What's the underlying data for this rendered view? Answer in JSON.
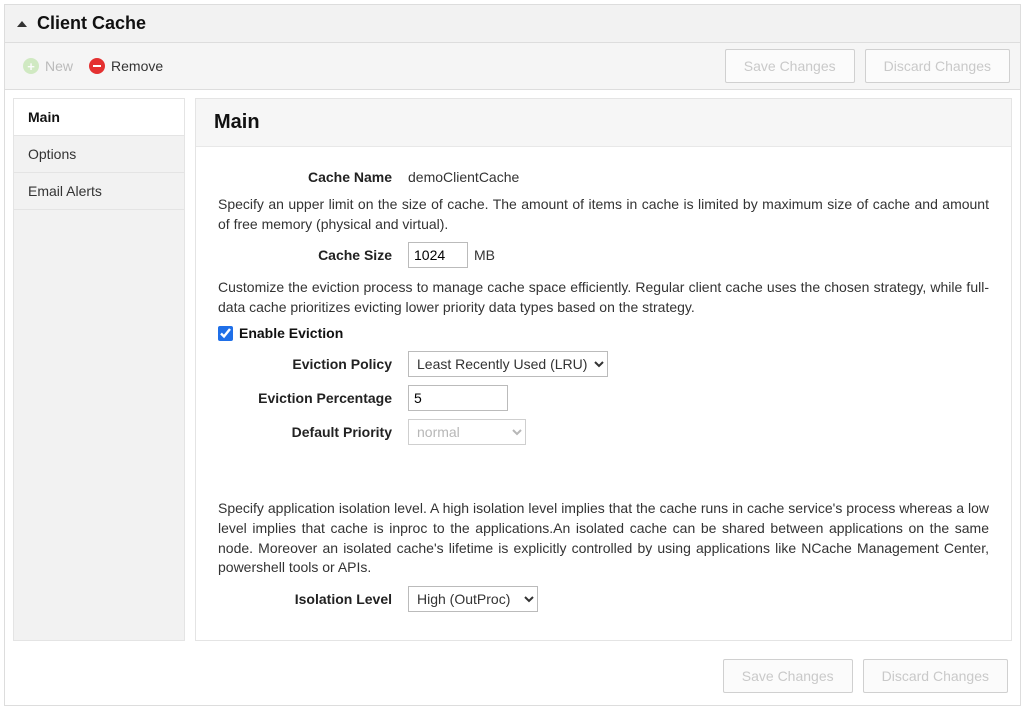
{
  "header": {
    "title": "Client Cache"
  },
  "toolbar": {
    "new_label": "New",
    "remove_label": "Remove",
    "save_label": "Save Changes",
    "discard_label": "Discard Changes"
  },
  "sidebar": {
    "tabs": [
      {
        "label": "Main",
        "active": true
      },
      {
        "label": "Options",
        "active": false
      },
      {
        "label": "Email Alerts",
        "active": false
      }
    ]
  },
  "content": {
    "title": "Main",
    "cache_name_label": "Cache Name",
    "cache_name_value": "demoClientCache",
    "size_desc": "Specify an upper limit on the size of cache. The amount of items in cache is limited by maximum size of cache and amount of free memory (physical and virtual).",
    "cache_size_label": "Cache Size",
    "cache_size_value": "1024",
    "cache_size_unit": "MB",
    "eviction_desc": "Customize the eviction process to manage cache space efficiently. Regular client cache uses the chosen strategy, while full-data cache prioritizes evicting lower priority data types based on the strategy.",
    "enable_eviction_label": "Enable Eviction",
    "enable_eviction_checked": true,
    "eviction_policy_label": "Eviction Policy",
    "eviction_policy_value": "Least Recently Used (LRU)",
    "eviction_percentage_label": "Eviction Percentage",
    "eviction_percentage_value": "5",
    "default_priority_label": "Default Priority",
    "default_priority_value": "normal",
    "isolation_desc": "Specify application isolation level. A high isolation level implies that the cache runs in cache service's process whereas a low level implies that cache is inproc to the applications.An isolated cache can be shared between applications on the same node. Moreover an isolated cache's lifetime is explicitly controlled by using applications like NCache Management Center, powershell tools or APIs.",
    "isolation_level_label": "Isolation Level",
    "isolation_level_value": "High (OutProc)"
  },
  "footer": {
    "save_label": "Save Changes",
    "discard_label": "Discard Changes"
  }
}
